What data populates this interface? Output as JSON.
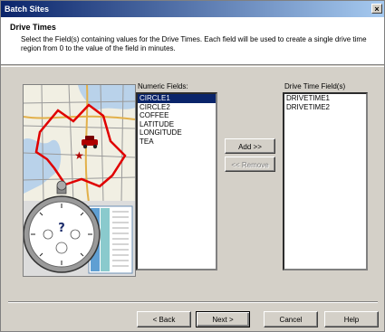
{
  "window": {
    "title": "Batch Sites",
    "close_label": "×"
  },
  "header": {
    "title": "Drive Times",
    "description": "Select the Field(s) containing values for the Drive Times.  Each field will be used to create a single drive time region from 0 to the value of the field in minutes."
  },
  "numeric_fields": {
    "label": "Numeric Fields:",
    "items": [
      "CIRCLE1",
      "CIRCLE2",
      "COFFEE",
      "LATITUDE",
      "LONGITUDE",
      "TEA"
    ],
    "selected": "CIRCLE1"
  },
  "drive_time_fields": {
    "label": "Drive Time Field(s)",
    "items": [
      "DRIVETIME1",
      "DRIVETIME2"
    ]
  },
  "buttons": {
    "add": "Add >>",
    "remove": "<< Remove",
    "back": "< Back",
    "next": "Next >",
    "cancel": "Cancel",
    "help": "Help"
  },
  "colors": {
    "titlebar_start": "#0a246a",
    "titlebar_end": "#a6caf0",
    "selection": "#0a246a",
    "dialog_bg": "#d4d0c8",
    "drive_region": "#e00000"
  },
  "icons": [
    "close-icon",
    "map-illustration",
    "stopwatch-icon",
    "car-icon"
  ]
}
